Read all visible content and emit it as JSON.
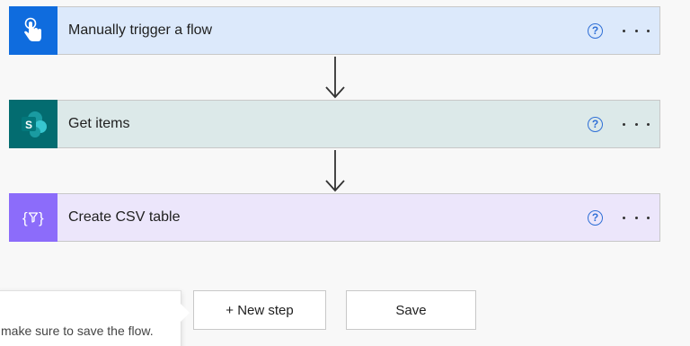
{
  "flow": {
    "steps": [
      {
        "title": "Manually trigger a flow",
        "icon": "touch-hand-icon",
        "color": "#0f6cde"
      },
      {
        "title": "Get items",
        "icon": "sharepoint-icon",
        "color": "#036c70"
      },
      {
        "title": "Create CSV table",
        "icon": "data-operation-icon",
        "color": "#8c6cfa"
      }
    ]
  },
  "actions": {
    "new_step_label": "+ New step",
    "save_label": "Save"
  },
  "tooltip": {
    "text": "make sure to save the flow."
  }
}
